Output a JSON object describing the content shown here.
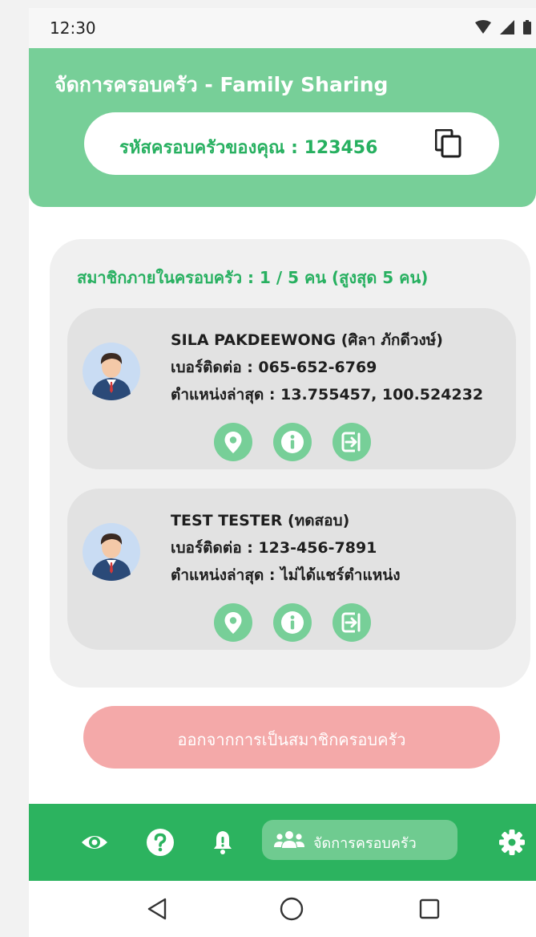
{
  "status_bar": {
    "time": "12:30",
    "icons": [
      "wifi-icon",
      "signal-icon",
      "battery-icon"
    ]
  },
  "header": {
    "title": "จัดการครอบครัว - Family Sharing",
    "family_code_label": "รหัสครอบครัวของคุณ : 123456",
    "copy_icon": "copy-icon"
  },
  "members": {
    "heading": "สมาชิกภายในครอบครัว : 1 / 5 คน (สูงสุด 5 คน)",
    "list": [
      {
        "name": "SILA PAKDEEWONG (ศิลา ภักดีวงษ์)",
        "phone": "เบอร์ติดต่อ : 065-652-6769",
        "location": "ตำแหน่งล่าสุด : 13.755457, 100.524232"
      },
      {
        "name": "TEST TESTER (ทดสอบ)",
        "phone": "เบอร์ติดต่อ : 123-456-7891",
        "location": "ตำแหน่งล่าสุด : ไม่ได้แชร์ตำแหน่ง"
      }
    ],
    "action_icons": [
      "location-pin-icon",
      "info-icon",
      "exit-icon"
    ]
  },
  "leave_button": {
    "label": "ออกจากการเป็นสมาชิกครอบครัว"
  },
  "bottom_nav": {
    "items": [
      "eye-icon",
      "help-icon",
      "bell-icon",
      "family-icon",
      "gear-icon"
    ],
    "active_label": "จัดการครอบครัว"
  },
  "system_nav": [
    "back-icon",
    "home-icon",
    "recents-icon"
  ],
  "colors": {
    "header_green": "#77cf98",
    "accent_green": "#27b060",
    "nav_green": "#2cb35f",
    "leave_pink": "#f4a9a9",
    "card_bg": "#f0f0f0",
    "member_bg": "#e2e2e2"
  }
}
